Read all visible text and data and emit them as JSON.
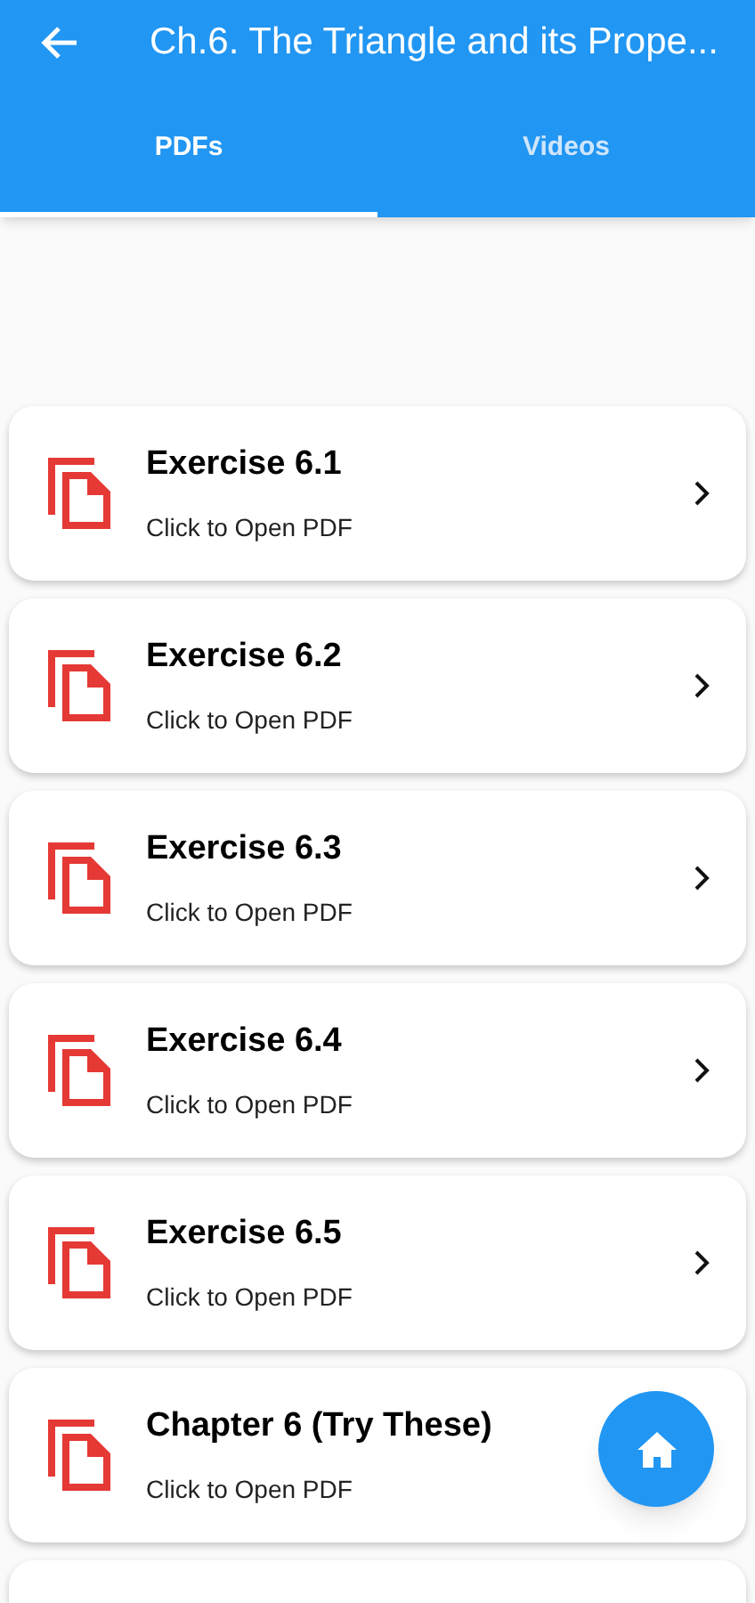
{
  "app_bar": {
    "title": "Ch.6. The Triangle and its Prope..."
  },
  "tabs": [
    {
      "label": "PDFs",
      "selected": true
    },
    {
      "label": "Videos",
      "selected": false
    }
  ],
  "items": [
    {
      "title": "Exercise 6.1",
      "subtitle": "Click to Open PDF",
      "arrow": true
    },
    {
      "title": "Exercise 6.2",
      "subtitle": "Click to Open PDF",
      "arrow": true
    },
    {
      "title": "Exercise 6.3",
      "subtitle": "Click to Open PDF",
      "arrow": true
    },
    {
      "title": "Exercise 6.4",
      "subtitle": "Click to Open PDF",
      "arrow": true
    },
    {
      "title": "Exercise 6.5",
      "subtitle": "Click to Open PDF",
      "arrow": true
    },
    {
      "title": "Chapter 6 (Try These)",
      "subtitle": "Click to Open PDF",
      "arrow": false
    }
  ]
}
